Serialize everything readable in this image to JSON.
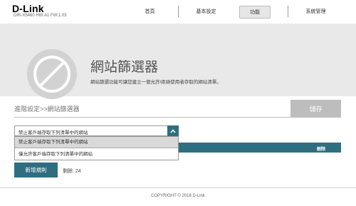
{
  "header": {
    "brand": "D-Link",
    "model_info": "DIR-X5460 HW:A1 FW:1.03",
    "nav": [
      {
        "label": "首頁"
      },
      {
        "label": "基本設定"
      },
      {
        "label": "功能"
      },
      {
        "label": "系統管理"
      }
    ],
    "active_nav": "功能"
  },
  "hero": {
    "icon": "website-filter-icon",
    "title": "網站篩選器",
    "description": "網站篩選功能可讓您建立一個允許/拒絕使用者存取的網站清單。"
  },
  "toolbar": {
    "breadcrumb": "進階設定>>網站篩選器",
    "save_label": "儲存"
  },
  "filter": {
    "selected": "禁止客戶端存取下列清單中的網站",
    "options": [
      "禁止客戶端存取下列清單中的網站",
      "僅允許客戶端存取下列清單中的網站"
    ]
  },
  "table": {
    "delete_header": "刪除"
  },
  "actions": {
    "add_rule_label": "新增規則",
    "remaining_label": "剩餘: 24"
  },
  "footer": {
    "copyright": "COPYRIGHT © 2018 D-Link"
  },
  "colors": {
    "accent": "#2f6e80",
    "hero_bg": "#e9e9e9",
    "save_disabled": "#bdbdbd"
  }
}
